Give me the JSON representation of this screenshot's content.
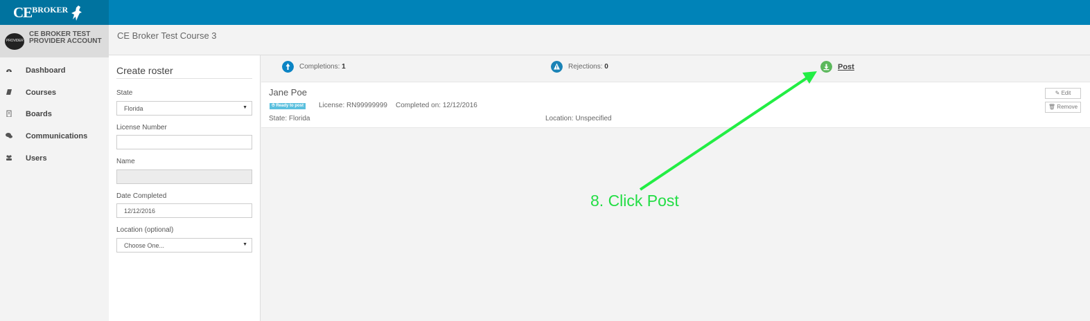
{
  "brand": {
    "logo_ce": "CE",
    "logo_broker": "BROKER"
  },
  "account": {
    "avatar_text": "PROVIDER",
    "name_line1": "CE BROKER TEST",
    "name_line2": "PROVIDER ACCOUNT"
  },
  "sidebar": {
    "items": [
      {
        "label": "Dashboard",
        "icon": "dashboard-icon"
      },
      {
        "label": "Courses",
        "icon": "book-icon"
      },
      {
        "label": "Boards",
        "icon": "building-icon"
      },
      {
        "label": "Communications",
        "icon": "chat-icon"
      },
      {
        "label": "Users",
        "icon": "users-icon"
      }
    ]
  },
  "header": {
    "course_title": "CE Broker Test Course 3"
  },
  "form": {
    "title": "Create roster",
    "state_label": "State",
    "state_value": "Florida",
    "license_label": "License Number",
    "license_value": "",
    "name_label": "Name",
    "name_value": "",
    "date_label": "Date Completed",
    "date_value": "12/12/2016",
    "location_label": "Location (optional)",
    "location_value": "Choose One..."
  },
  "stats": {
    "completions_label": "Completions:",
    "completions_value": "1",
    "rejections_label": "Rejections:",
    "rejections_value": "0",
    "post_label": "Post"
  },
  "entry": {
    "name": "Jane Poe",
    "badge": "⏱ Ready to post",
    "license": "License: RN99999999",
    "completed": "Completed on:  12/12/2016",
    "state": "State: Florida",
    "location": "Location:  Unspecified",
    "edit_label": "✎ Edit",
    "remove_label": "🗑 Remove"
  },
  "annotation": {
    "text": "8. Click Post"
  },
  "colors": {
    "topbar": "#0083b8",
    "completions": "#0b84c4",
    "rejections": "#1a83b6",
    "post": "#5cb85c",
    "annotation": "#22dd44",
    "badge": "#5bc0de"
  }
}
